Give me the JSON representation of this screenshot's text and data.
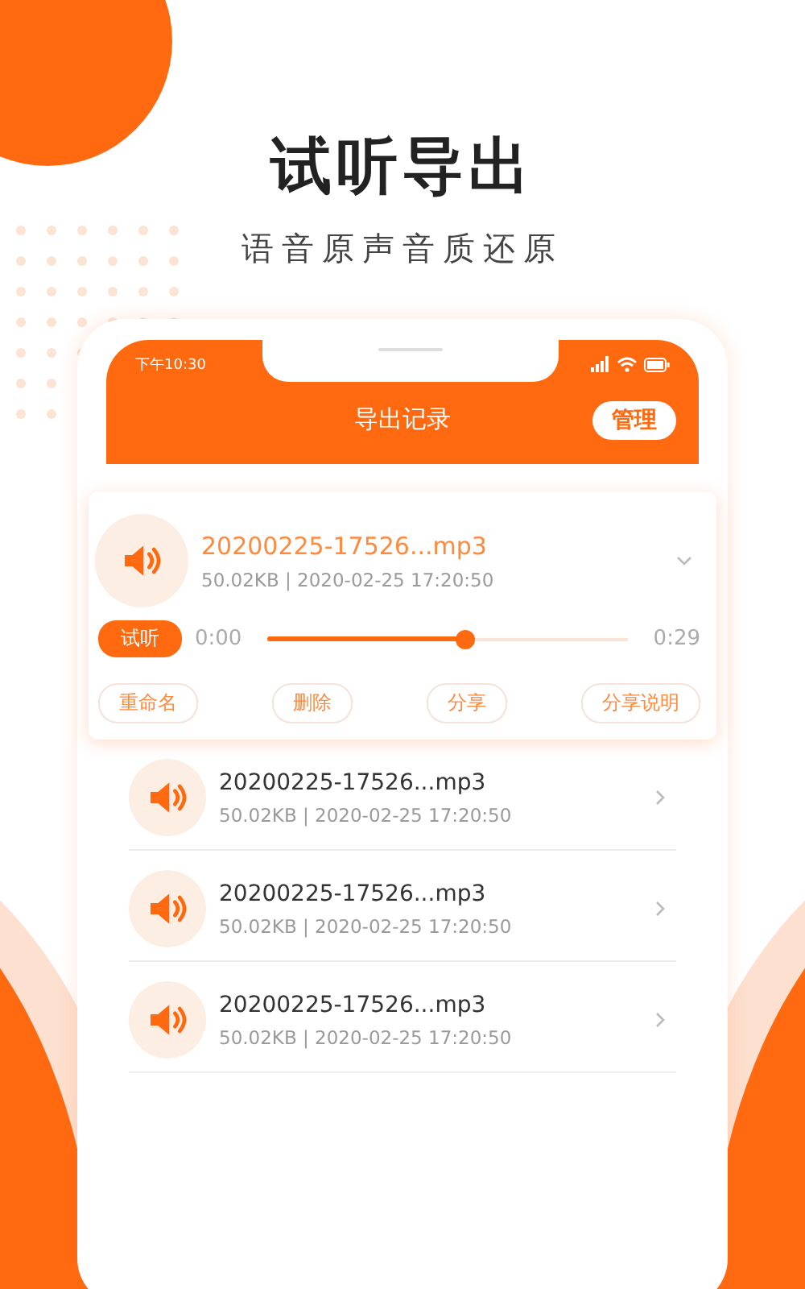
{
  "headline": "试听导出",
  "subheadline": "语音原声音质还原",
  "status_bar": {
    "time": "下午10:30"
  },
  "header": {
    "title": "导出记录",
    "action": "管理"
  },
  "records": [
    {
      "name": "20200225-17526...mp3",
      "meta": "50.02KB | 2020-02-25 17:20:50",
      "expanded": true,
      "play_label": "试听",
      "elapsed": "0:00",
      "level": 0.55,
      "duration": "0:29",
      "actions": [
        "重命名",
        "删除",
        "分享",
        "分享说明"
      ]
    },
    {
      "name": "20200225-17526...mp3",
      "meta": "50.02KB | 2020-02-25 17:20:50",
      "expanded": false
    },
    {
      "name": "20200225-17526...mp3",
      "meta": "50.02KB | 2020-02-25 17:20:50",
      "expanded": false
    },
    {
      "name": "20200225-17526...mp3",
      "meta": "50.02KB | 2020-02-25 17:20:50",
      "expanded": false
    }
  ]
}
